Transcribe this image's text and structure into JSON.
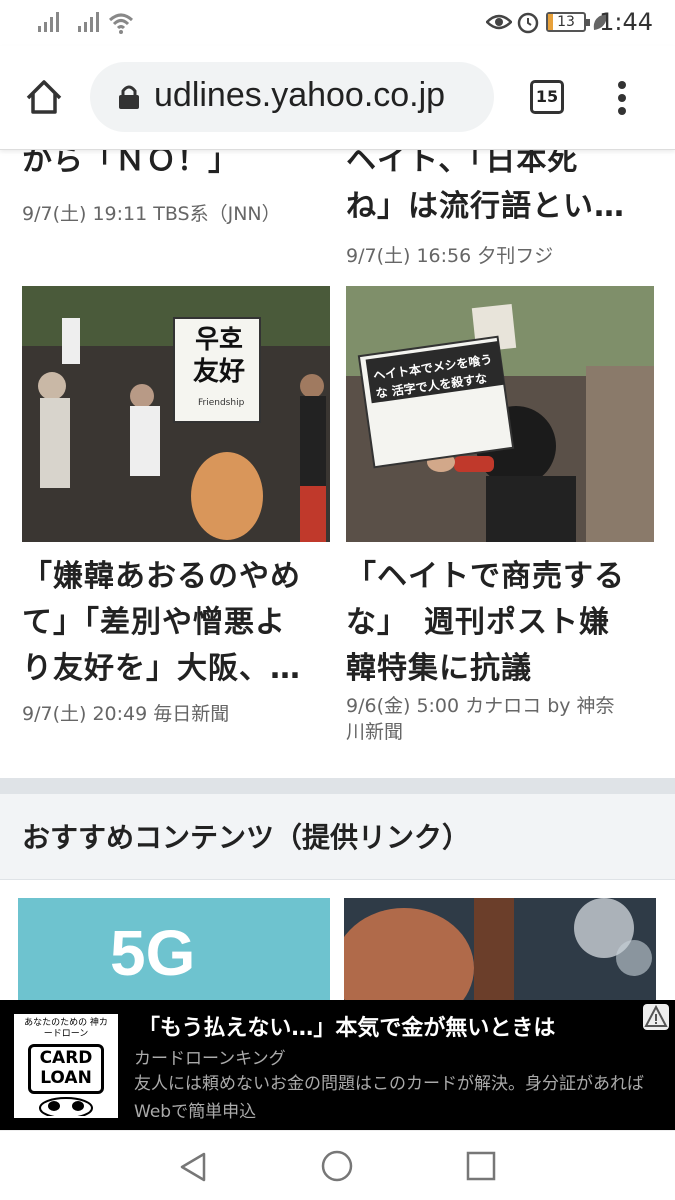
{
  "status_bar": {
    "time": "1:44",
    "battery": "13",
    "battery_level_percent": 13,
    "icons": [
      "signal-icon",
      "signal-icon",
      "wifi-icon",
      "eye-icon",
      "alarm-icon",
      "battery-icon",
      "leaf-icon"
    ]
  },
  "browser": {
    "url": "udlines.yahoo.co.jp",
    "tab_count": "15",
    "icons": [
      "home-icon",
      "lock-icon",
      "tabs-icon",
      "menu-icon"
    ]
  },
  "articles": [
    {
      "title_line": "から「ＮＯ！」",
      "meta": "9/7(土) 19:11  TBS系（JNN）"
    },
    {
      "title_lines": [
        "ヘイト、「日本死",
        "ね」は流行語とい…"
      ],
      "meta": "9/7(土) 16:56  夕刊フジ"
    },
    {
      "title_lines": [
        "「嫌韓あおるのやめ",
        "て」「差別や憎悪よ",
        "り友好を」大阪、…"
      ],
      "meta": "9/7(土) 20:49  毎日新聞",
      "photo_sign": "우호 友好",
      "photo_sign_sub": "Friendship"
    },
    {
      "title_lines": [
        "「ヘイトで商売する",
        "な」　週刊ポスト嫌",
        "韓特集に抗議"
      ],
      "meta_lines": [
        "9/6(金) 5:00  カナロコ by 神奈",
        "川新聞"
      ],
      "photo_sign": "ヘイト本でメシを喰うな 活字で人を殺すな"
    }
  ],
  "section": {
    "heading": "おすすめコンテンツ（提供リンク）",
    "tile_text": "5G"
  },
  "ad": {
    "title": "「もう払えない…」本気で金が無いときは",
    "source": "カードローンキング",
    "description": "友人には頼めないお金の問題はこのカードが解決。身分証があればWebで簡単申込",
    "logo_caption": "あなたのための 神カードローン",
    "logo_lines": [
      "CARD",
      "LOAN"
    ]
  },
  "colors": {
    "accent_battery": "#e8a13a",
    "separator": "#dfe3e7",
    "ad_bg": "#000000",
    "tile_5g": "#6ec3cf"
  }
}
